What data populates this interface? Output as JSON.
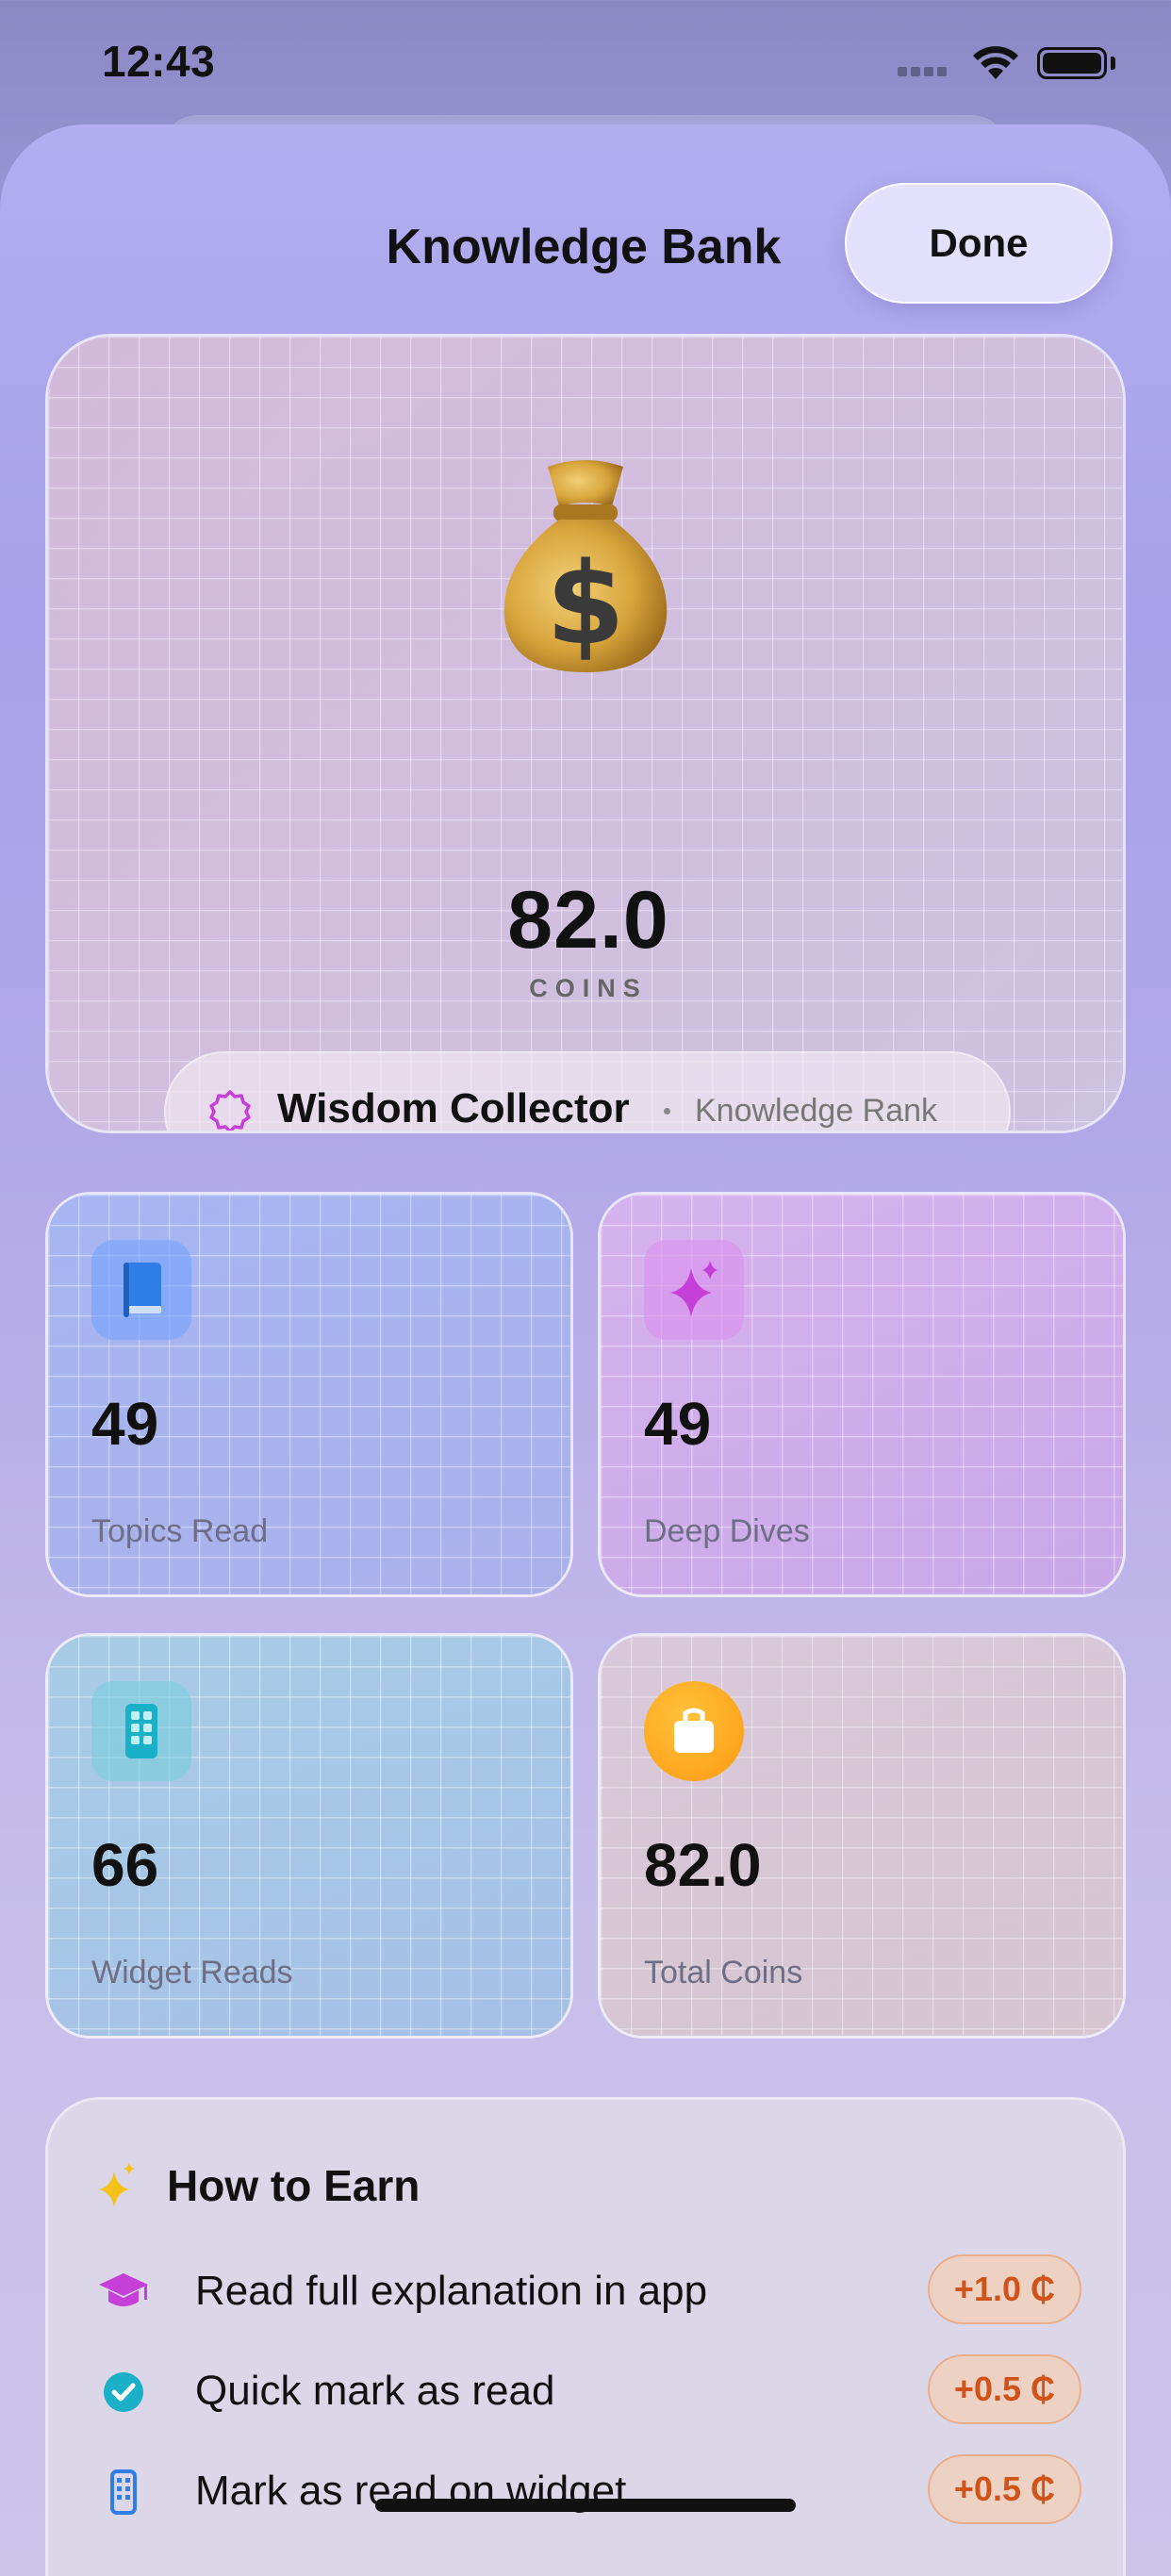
{
  "status_bar": {
    "time": "12:43"
  },
  "header": {
    "title": "Knowledge Bank",
    "done_label": "Done"
  },
  "hero": {
    "icon": "money-bag-emoji",
    "coins_value": "82.0",
    "coins_label": "COINS",
    "rank": {
      "name": "Wisdom Collector",
      "subtitle": "Knowledge Rank"
    }
  },
  "stats": [
    {
      "icon": "book-icon",
      "value": "49",
      "label": "Topics Read",
      "accent": "#2f7de6"
    },
    {
      "icon": "sparkles-icon",
      "value": "49",
      "label": "Deep Dives",
      "accent": "#c53fd8"
    },
    {
      "icon": "phone-widget-icon",
      "value": "66",
      "label": "Widget Reads",
      "accent": "#19b0c8"
    },
    {
      "icon": "bag-icon",
      "value": "82.0",
      "label": "Total Coins",
      "accent": "#ff9a12"
    }
  ],
  "how_to_earn": {
    "title": "How to Earn",
    "items": [
      {
        "icon": "graduation-cap-icon",
        "text": "Read full explanation in app",
        "reward": "+1.0 ₵"
      },
      {
        "icon": "checkmark-circle-icon",
        "text": "Quick mark as read",
        "reward": "+0.5 ₵"
      },
      {
        "icon": "phone-widget-icon",
        "text": "Mark as read on widget",
        "reward": "+0.5 ₵"
      }
    ]
  }
}
